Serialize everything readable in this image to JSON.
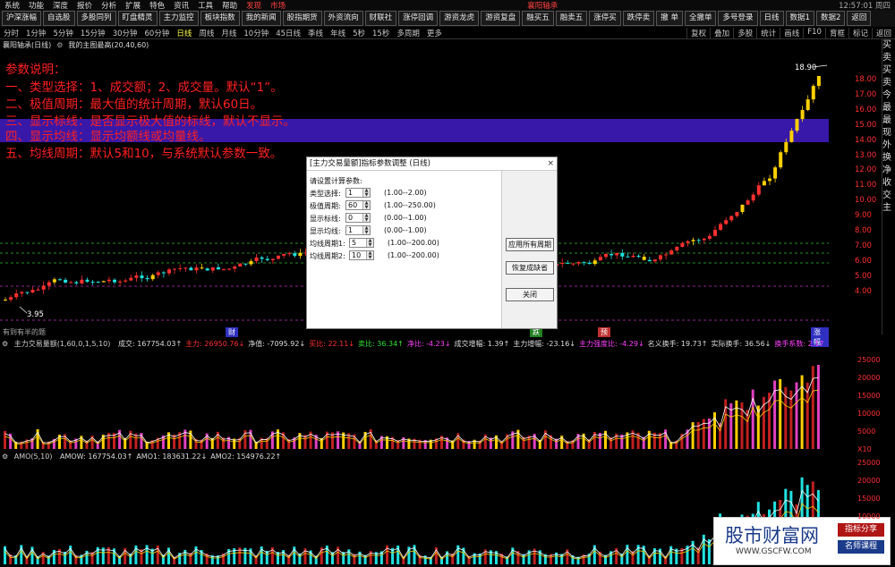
{
  "menubar": {
    "items": [
      "系统",
      "功能",
      "深度",
      "报价",
      "分析",
      "扩展",
      "特色",
      "资讯",
      "工具",
      "帮助"
    ],
    "discover": "发现",
    "market": "市场",
    "stock_title": "襄阳轴承",
    "clock": "12:57:01 周四"
  },
  "toolbar": {
    "items": [
      "沪深涨幅",
      "自选股",
      "多股同列",
      "盯盘精灵",
      "主力监控",
      "板块指数",
      "我的新闻",
      "股指期货",
      "外资流向",
      "财联社",
      "涨停回调",
      "游资龙虎",
      "游资复盘",
      "融买五",
      "融卖五",
      "涨停买",
      "跌停卖",
      "撤 单",
      "全撤单",
      "多号登录",
      "日线",
      "数据1",
      "数据2",
      "返回"
    ]
  },
  "periodbar": {
    "items": [
      "分时",
      "1分钟",
      "5分钟",
      "15分钟",
      "30分钟",
      "60分钟",
      "日线",
      "周线",
      "月线",
      "10分钟",
      "45日线",
      "季线",
      "年线",
      "5秒",
      "15秒",
      "多周期",
      "更多"
    ],
    "active": "日线",
    "right_items": [
      "复权",
      "叠加",
      "多股",
      "统计",
      "画线",
      "F10",
      "育框",
      "标记",
      "返回"
    ]
  },
  "infobar": {
    "stock": "襄阳轴承(日线)",
    "indicator": "我的主图最高(20,40,60)"
  },
  "explain": {
    "title": "参数说明：",
    "lines": [
      "一、类型选择：1、成交额；2、成交量。默认“1”。",
      "二、极值周期：最大值的统计周期，默认60日。",
      "三、显示标线：是否显示极大值的标线，默认不显示。",
      "四、显示均线：显示均额线或均量线。",
      "五、均线周期：默认5和10，与系统默认参数一致。"
    ]
  },
  "price_labels": {
    "high": "18.90",
    "low": "3.95"
  },
  "price_scale": [
    "18.00",
    "17.00",
    "16.00",
    "15.00",
    "14.00",
    "13.00",
    "12.00",
    "11.00",
    "10.00",
    "9.00",
    "8.00",
    "7.00",
    "6.00",
    "5.00",
    "4.00"
  ],
  "side_panel": [
    "买",
    "卖",
    "买",
    "卖",
    "今",
    "最",
    "最",
    "现",
    "外",
    "换",
    "净",
    "收",
    "交",
    "主"
  ],
  "event_markers": {
    "left_label": "有到有半的题",
    "m1": "财",
    "m2": "跌",
    "m3": "预",
    "m4": "涨幅"
  },
  "dialog": {
    "title": "[主力交易量额]指标参数调整 (日线)",
    "close": "×",
    "heading": "请设置计算参数:",
    "params": [
      {
        "label": "类型选择:",
        "value": "1",
        "range": "(1.00--2.00)"
      },
      {
        "label": "极值周期:",
        "value": "60",
        "range": "(1.00--250.00)"
      },
      {
        "label": "显示标线:",
        "value": "0",
        "range": "(0.00--1.00)"
      },
      {
        "label": "显示均线:",
        "value": "1",
        "range": "(0.00--1.00)"
      },
      {
        "label": "均线周期1:",
        "value": "5",
        "range": "(1.00--200.00)"
      },
      {
        "label": "均线周期2:",
        "value": "10",
        "range": "(1.00--200.00)"
      }
    ],
    "apply_all": "应用所有周期",
    "restore": "恢复成缺省",
    "close_btn": "关闭"
  },
  "indicator1": {
    "name": "主力交易量额(1,60,0,1,5,10)",
    "items": [
      {
        "text": "成交: 167754.03↑",
        "color": "#dddddd"
      },
      {
        "text": "主力: 26950.76↓",
        "color": "#ff3030"
      },
      {
        "text": "净值: -7095.92↓",
        "color": "#dddddd"
      },
      {
        "text": "买比: 22.11↓",
        "color": "#ff3030"
      },
      {
        "text": "卖比: 36.34↑",
        "color": "#30e030"
      },
      {
        "text": "净比: -4.23↓",
        "color": "#ff40ff"
      },
      {
        "text": "成交增幅: 1.39↑",
        "color": "#dddddd"
      },
      {
        "text": "主力增幅: -23.16↓",
        "color": "#dddddd"
      },
      {
        "text": "主力强度比: -4.29↓",
        "color": "#ff40ff"
      },
      {
        "text": "名义换手: 19.73↑",
        "color": "#dddddd"
      },
      {
        "text": "实际换手: 36.56↓",
        "color": "#dddddd"
      },
      {
        "text": "换手系数: 2.17",
        "color": "#ff40ff"
      }
    ],
    "scale": [
      "25000",
      "20000",
      "15000",
      "10000",
      "5000",
      "X10"
    ]
  },
  "indicator2": {
    "name": "AMO(5,10)",
    "items": [
      {
        "text": "AMOW: 167754.03↑",
        "color": "#dddddd"
      },
      {
        "text": "AMO1: 183631.22↓",
        "color": "#dddddd"
      },
      {
        "text": "AMO2: 154976.22↑",
        "color": "#dddddd"
      }
    ],
    "scale": [
      "25000",
      "20000",
      "15000",
      "10000"
    ]
  },
  "watermark": {
    "brand": "股市财富网",
    "url": "WWW.GSCFW.COM",
    "tag1": "指标分享",
    "tag2": "名师课程"
  },
  "colors": {
    "up": "#ff3030",
    "down": "#20e0e0",
    "highlight": "#ffee00",
    "band": "#3818a8"
  }
}
